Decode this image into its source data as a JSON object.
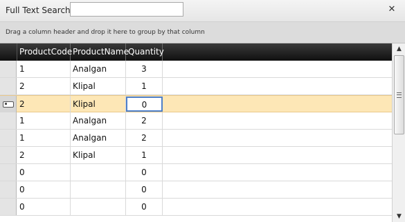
{
  "search": {
    "label": "Full Text Search",
    "value": ""
  },
  "close_icon": "✕",
  "group_panel": {
    "hint": "Drag a column header and drop it here to group by that column"
  },
  "columns": [
    {
      "key": "ProductCode",
      "label": "ProductCode"
    },
    {
      "key": "ProductName",
      "label": "ProductName"
    },
    {
      "key": "Quantity",
      "label": "Quantity"
    }
  ],
  "rows": [
    {
      "code": "1",
      "name": "Analgan",
      "qty": "3",
      "selected": false
    },
    {
      "code": "2",
      "name": "Klipal",
      "qty": "1",
      "selected": false
    },
    {
      "code": "2",
      "name": "Klipal",
      "qty": "0",
      "selected": true
    },
    {
      "code": "1",
      "name": "Analgan",
      "qty": "2",
      "selected": false
    },
    {
      "code": "1",
      "name": "Analgan",
      "qty": "2",
      "selected": false
    },
    {
      "code": "2",
      "name": "Klipal",
      "qty": "1",
      "selected": false
    },
    {
      "code": "0",
      "name": "",
      "qty": "0",
      "selected": false
    },
    {
      "code": "0",
      "name": "",
      "qty": "0",
      "selected": false
    },
    {
      "code": "0",
      "name": "",
      "qty": "0",
      "selected": false
    }
  ],
  "scrollbar": {
    "up_icon": "▲",
    "down_icon": "▼"
  },
  "colors": {
    "selected_row": "#fde7b6",
    "header": "#1e1e1e",
    "edit_border": "#4d7fc9"
  }
}
